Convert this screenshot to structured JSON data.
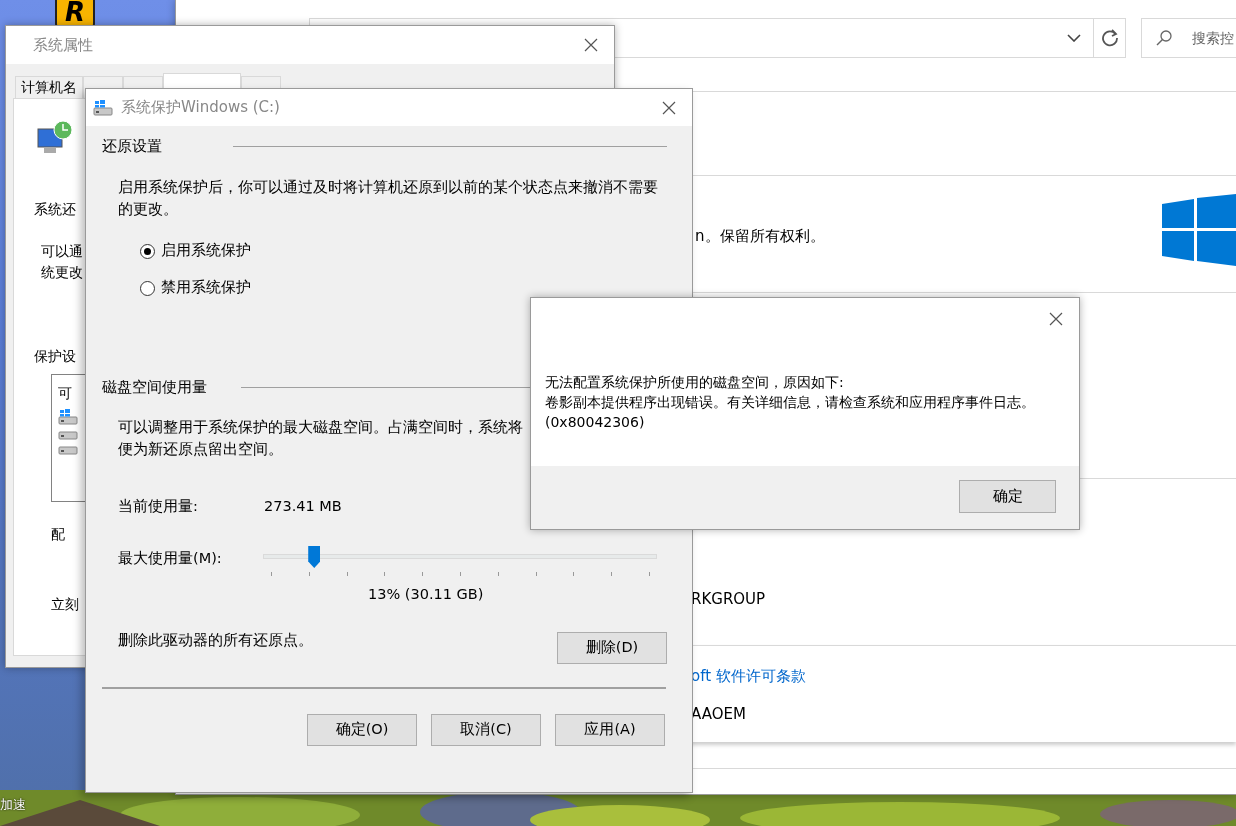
{
  "desktop": {
    "app_icon_letter": "R",
    "icon_label": "加速"
  },
  "control_panel": {
    "search": {
      "placeholder": "搜索控"
    },
    "copyright_text": "n。保留所有权利。",
    "workgroup_text": "RKGROUP",
    "license_link": "oft 软件许可条款",
    "product_text": "AAOEM"
  },
  "system_properties": {
    "title": "系统属性",
    "tabs": [
      {
        "label": "计算机名",
        "selected": false
      },
      {
        "selected": false
      },
      {
        "selected": false
      },
      {
        "selected": true
      },
      {
        "selected": false
      }
    ],
    "panel": {
      "heading": "系统还",
      "description_lines": [
        "可以通",
        "统更改"
      ],
      "section": "保护设",
      "list_header": "可",
      "list_items": [
        {
          "kind": "windows"
        },
        {
          "kind": "drive"
        },
        {
          "kind": "drive"
        }
      ],
      "configure_text": "配",
      "create_text": "立刻"
    }
  },
  "protection_dialog": {
    "title": "系统保护Windows (C:)",
    "restore_group": "还原设置",
    "restore_text": "启用系统保护后，你可以通过及时将计算机还原到以前的某个状态点来撤消不需要的更改。",
    "options": [
      {
        "label": "启用系统保护",
        "selected": true
      },
      {
        "label": "禁用系统保护",
        "selected": false
      }
    ],
    "disk_group": "磁盘空间使用量",
    "disk_text_lines": [
      "可以调整用于系统保护的最大磁盘空间。占满空间时，系统将",
      "便为新还原点留出空间。"
    ],
    "current_label": "当前使用量:",
    "current_value": "273.41 MB",
    "max_label": "最大使用量(M):",
    "slider": {
      "level": 0.13
    },
    "slider_reading": "13% (30.11 GB)",
    "delete_text": "删除此驱动器的所有还原点。",
    "delete_button": "删除(D)",
    "buttons": [
      "确定(O)",
      "取消(C)",
      "应用(A)"
    ]
  },
  "error_dialog": {
    "message_lines": [
      "无法配置系统保护所使用的磁盘空间，原因如下:",
      "卷影副本提供程序出现错误。有关详细信息，请检查系统和应用程序事件日志。",
      "(0x80042306)"
    ],
    "button": "确定"
  }
}
